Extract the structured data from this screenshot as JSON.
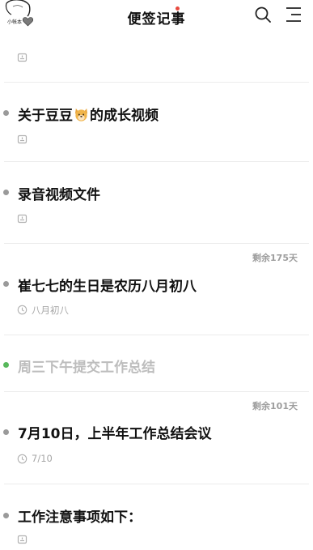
{
  "header": {
    "title": "便签记事",
    "avatar_name": "小帐本"
  },
  "notes": [
    {
      "title": "关于豆豆",
      "title_tail": "的成长视频",
      "emoji": "dog-face"
    },
    {
      "title": "录音视频文件"
    },
    {
      "title": "崔七七的生日是农历八月初八",
      "remaining": "剩余175天",
      "meta": "八月初八"
    },
    {
      "title": "周三下午提交工作总结",
      "done": true
    },
    {
      "title": "7月10日，上半年工作总结会议",
      "remaining": "剩余101天",
      "meta": "7/10"
    },
    {
      "title": "工作注意事项如下："
    }
  ],
  "colors": {
    "done_bullet": "#58b85c",
    "bullet": "#9a9a9a",
    "badge": "#e84a3f"
  }
}
